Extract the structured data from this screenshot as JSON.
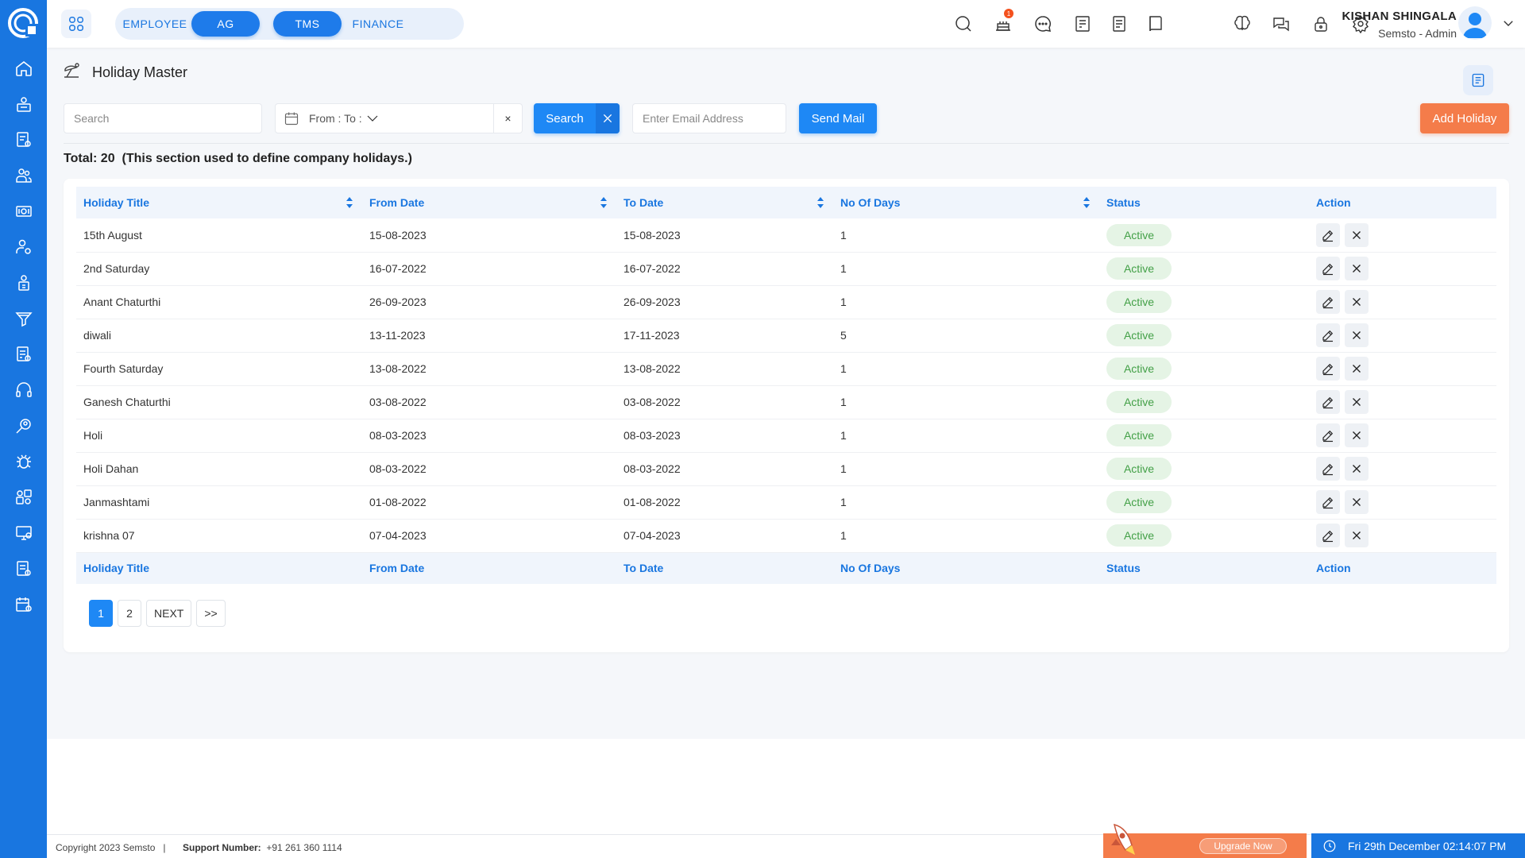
{
  "modules": {
    "group1": [
      "EMPLOYEE",
      "AG"
    ],
    "group2": [
      "TMS",
      "FINANCE"
    ]
  },
  "user": {
    "name": "KISHAN SHINGALA",
    "role": "Semsto - Admin"
  },
  "notifications": {
    "count": "1"
  },
  "page": {
    "title": "Holiday Master"
  },
  "filters": {
    "search_placeholder": "Search",
    "date_range_label": "From : To :",
    "clear_label": "×",
    "search_button": "Search",
    "email_placeholder": "Enter Email Address",
    "send_mail_button": "Send Mail",
    "add_button": "Add Holiday"
  },
  "summary": {
    "total": "Total: 20",
    "note": "(This section used to define company holidays.)"
  },
  "table": {
    "headers": [
      "Holiday Title",
      "From Date",
      "To Date",
      "No Of Days",
      "Status",
      "Action"
    ],
    "rows": [
      [
        "15th August",
        "15-08-2023",
        "15-08-2023",
        "1",
        "Active"
      ],
      [
        "2nd Saturday",
        "16-07-2022",
        "16-07-2022",
        "1",
        "Active"
      ],
      [
        "Anant Chaturthi",
        "26-09-2023",
        "26-09-2023",
        "1",
        "Active"
      ],
      [
        "diwali",
        "13-11-2023",
        "17-11-2023",
        "5",
        "Active"
      ],
      [
        "Fourth Saturday",
        "13-08-2022",
        "13-08-2022",
        "1",
        "Active"
      ],
      [
        "Ganesh Chaturthi",
        "03-08-2022",
        "03-08-2022",
        "1",
        "Active"
      ],
      [
        "Holi",
        "08-03-2023",
        "08-03-2023",
        "1",
        "Active"
      ],
      [
        "Holi Dahan",
        "08-03-2022",
        "08-03-2022",
        "1",
        "Active"
      ],
      [
        "Janmashtami",
        "01-08-2022",
        "01-08-2022",
        "1",
        "Active"
      ],
      [
        "krishna 07",
        "07-04-2023",
        "07-04-2023",
        "1",
        "Active"
      ]
    ]
  },
  "pagination": {
    "pages": [
      "1",
      "2"
    ],
    "next": "NEXT",
    "last": ">>"
  },
  "footer": {
    "copyright": "Copyright 2023 Semsto",
    "separator": "|",
    "support_label": "Support Number:",
    "support_number": "+91 261 360 1114",
    "upgrade": "Upgrade Now",
    "datetime": "Fri 29th December 02:14:07 PM"
  },
  "colors": {
    "primary": "#1976e0",
    "accent": "#f47c4a",
    "active_green": "#43a047"
  }
}
